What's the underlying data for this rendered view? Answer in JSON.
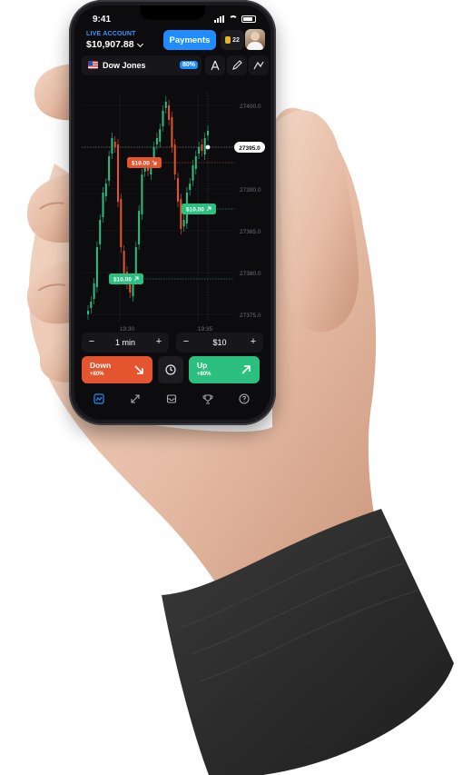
{
  "status_bar": {
    "time": "9:41"
  },
  "account": {
    "label": "LIVE ACCOUNT",
    "balance": "$10,907.88"
  },
  "header": {
    "payments_label": "Payments",
    "coins": "22"
  },
  "asset": {
    "name": "Dow Jones",
    "payout": "80%"
  },
  "toolbar": [
    "compass-icon",
    "pencil-icon",
    "indicator-icon"
  ],
  "chart_data": {
    "type": "candlestick",
    "price_ticks": [
      "27400.0",
      "27395.0",
      "27390.0",
      "27385.0",
      "27380.0",
      "27375.0"
    ],
    "current_price": "27395.0",
    "time_ticks": [
      "19:30",
      "19:35"
    ],
    "trades": [
      {
        "label": "$10.00",
        "direction": "down"
      },
      {
        "label": "$10.00",
        "direction": "up"
      },
      {
        "label": "$10.00",
        "direction": "up"
      }
    ],
    "colors": {
      "up": "#2bbf80",
      "down": "#e4542e",
      "trade_line": "#e4542e"
    }
  },
  "controls": {
    "duration": "1 min",
    "amount": "$10",
    "minus": "−",
    "plus": "+"
  },
  "trade_buttons": {
    "down_label": "Down",
    "down_payout": "+80%",
    "up_label": "Up",
    "up_payout": "+80%"
  },
  "tabbar": [
    "chart-icon",
    "trades-icon",
    "inbox-icon",
    "trophy-icon",
    "help-icon"
  ],
  "colors": {
    "accent": "#1f8cff",
    "up": "#2bbf80",
    "down": "#e4542e"
  }
}
